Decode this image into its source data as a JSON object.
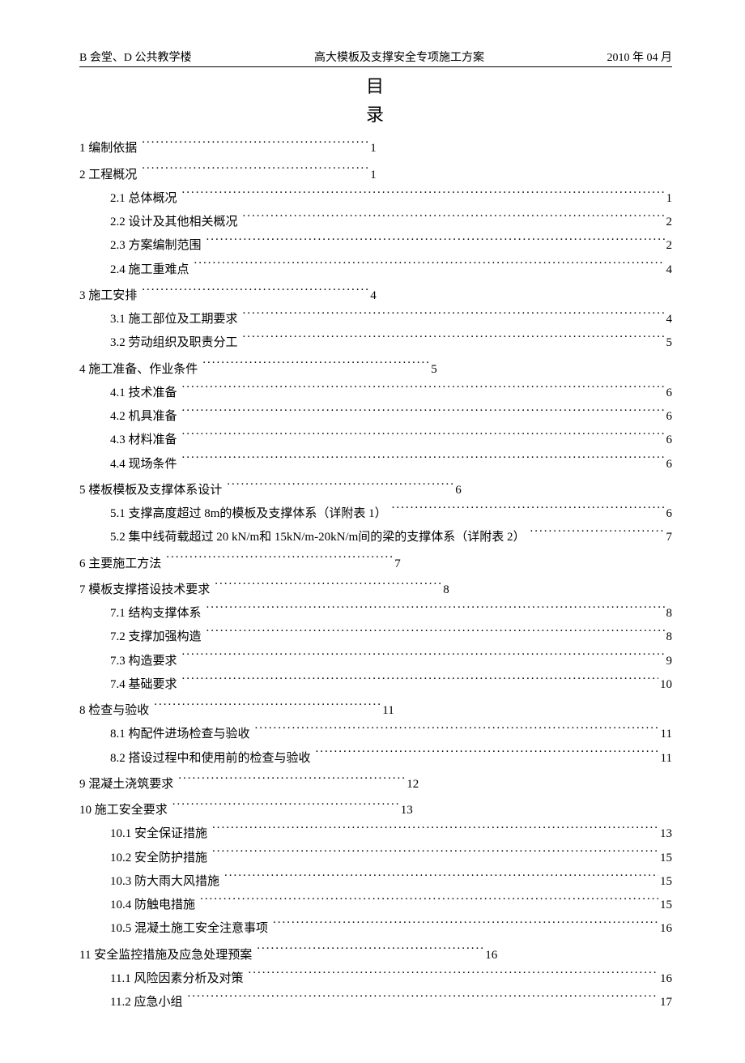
{
  "header": {
    "left": "B 会堂、D 公共教学楼",
    "center": "高大模板及支撑安全专项施工方案",
    "right": "2010 年 04 月"
  },
  "title": {
    "char1": "目",
    "char2": "录"
  },
  "toc": [
    {
      "level": 1,
      "short": true,
      "label": "1 编制依据",
      "page": "1"
    },
    {
      "level": 1,
      "short": true,
      "label": "2 工程概况",
      "page": "1"
    },
    {
      "level": 2,
      "short": false,
      "label": "2.1 总体概况",
      "page": "1"
    },
    {
      "level": 2,
      "short": false,
      "label": "2.2 设计及其他相关概况",
      "page": "2"
    },
    {
      "level": 2,
      "short": false,
      "label": "2.3 方案编制范围",
      "page": "2"
    },
    {
      "level": 2,
      "short": false,
      "label": "2.4 施工重难点",
      "page": "4"
    },
    {
      "level": 1,
      "short": true,
      "label": "3 施工安排",
      "page": "4"
    },
    {
      "level": 2,
      "short": false,
      "label": "3.1 施工部位及工期要求",
      "page": "4"
    },
    {
      "level": 2,
      "short": false,
      "label": "3.2 劳动组织及职责分工",
      "page": "5"
    },
    {
      "level": 1,
      "short": true,
      "label": "4 施工准备、作业条件",
      "page": "5"
    },
    {
      "level": 2,
      "short": false,
      "label": "4.1 技术准备",
      "page": "6"
    },
    {
      "level": 2,
      "short": false,
      "label": "4.2 机具准备",
      "page": "6"
    },
    {
      "level": 2,
      "short": false,
      "label": "4.3 材料准备",
      "page": "6"
    },
    {
      "level": 2,
      "short": false,
      "label": "4.4 现场条件",
      "page": "6"
    },
    {
      "level": 1,
      "short": true,
      "label": "5 楼板模板及支撑体系设计",
      "page": "6"
    },
    {
      "level": 2,
      "short": false,
      "label": "5.1 支撑高度超过 8m的模板及支撑体系（详附表 1）",
      "page": "6"
    },
    {
      "level": 2,
      "short": false,
      "label": "5.2 集中线荷载超过 20 kN/m和 15kN/m-20kN/m间的梁的支撑体系（详附表 2）",
      "page": "7"
    },
    {
      "level": 1,
      "short": true,
      "label": "6 主要施工方法",
      "page": "7"
    },
    {
      "level": 1,
      "short": true,
      "label": "7 模板支撑搭设技术要求",
      "page": "8"
    },
    {
      "level": 2,
      "short": false,
      "label": "7.1 结构支撑体系",
      "page": "8"
    },
    {
      "level": 2,
      "short": false,
      "label": "7.2 支撑加强构造",
      "page": "8"
    },
    {
      "level": 2,
      "short": false,
      "label": "7.3 构造要求",
      "page": "9"
    },
    {
      "level": 2,
      "short": false,
      "label": "7.4 基础要求",
      "page": "10"
    },
    {
      "level": 1,
      "short": true,
      "label": "8 检查与验收",
      "page": "11"
    },
    {
      "level": 2,
      "short": false,
      "label": "8.1 构配件进场检查与验收",
      "page": " 11"
    },
    {
      "level": 2,
      "short": false,
      "label": "8.2 搭设过程中和使用前的检查与验收",
      "page": " 11"
    },
    {
      "level": 1,
      "short": true,
      "label": "9 混凝土浇筑要求",
      "page": "12"
    },
    {
      "level": 1,
      "short": true,
      "label": "10 施工安全要求",
      "page": "13"
    },
    {
      "level": 2,
      "short": false,
      "label": "10.1 安全保证措施",
      "page": "13"
    },
    {
      "level": 2,
      "short": false,
      "label": "10.2 安全防护措施",
      "page": "15"
    },
    {
      "level": 2,
      "short": false,
      "label": "10.3 防大雨大风措施",
      "page": "15"
    },
    {
      "level": 2,
      "short": false,
      "label": "10.4 防触电措施",
      "page": "15"
    },
    {
      "level": 2,
      "short": false,
      "label": "10.5 混凝土施工安全注意事项",
      "page": "16"
    },
    {
      "level": 1,
      "short": true,
      "label": "11 安全监控措施及应急处理预案",
      "page": "16"
    },
    {
      "level": 2,
      "short": false,
      "label": "11.1 风险因素分析及对策",
      "page": "16"
    },
    {
      "level": 2,
      "short": false,
      "label": "11.2 应急小组",
      "page": "17"
    }
  ]
}
